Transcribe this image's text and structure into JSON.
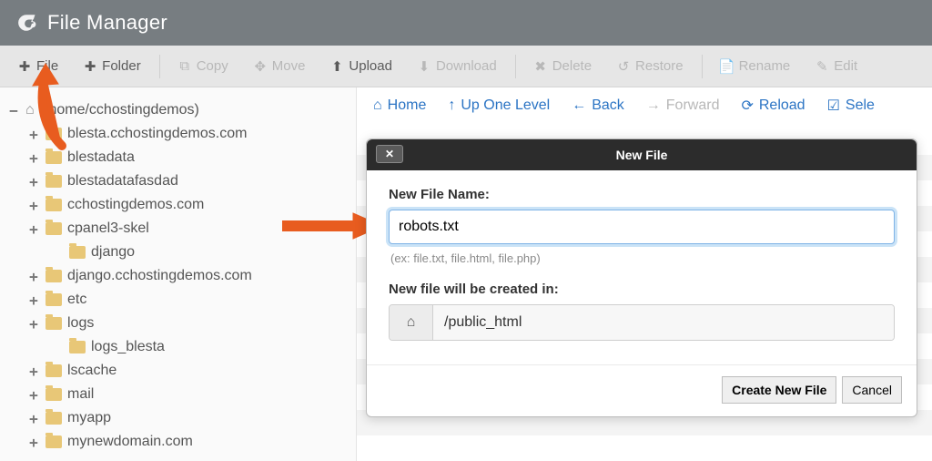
{
  "header": {
    "title": "File Manager"
  },
  "toolbar": {
    "file": "File",
    "folder": "Folder",
    "copy": "Copy",
    "move": "Move",
    "upload": "Upload",
    "download": "Download",
    "delete": "Delete",
    "restore": "Restore",
    "rename": "Rename",
    "edit": "Edit"
  },
  "tree": {
    "root_label": "(/home/cchostingdemos)",
    "items": [
      {
        "label": "blesta.cchostingdemos.com",
        "depth": 1,
        "toggle": "+"
      },
      {
        "label": "blestadata",
        "depth": 1,
        "toggle": "+"
      },
      {
        "label": "blestadatafasdad",
        "depth": 1,
        "toggle": "+"
      },
      {
        "label": "cchostingdemos.com",
        "depth": 1,
        "toggle": "+"
      },
      {
        "label": "cpanel3-skel",
        "depth": 1,
        "toggle": "+"
      },
      {
        "label": "django",
        "depth": 2,
        "toggle": ""
      },
      {
        "label": "django.cchostingdemos.com",
        "depth": 1,
        "toggle": "+"
      },
      {
        "label": "etc",
        "depth": 1,
        "toggle": "+"
      },
      {
        "label": "logs",
        "depth": 1,
        "toggle": "+"
      },
      {
        "label": "logs_blesta",
        "depth": 2,
        "toggle": ""
      },
      {
        "label": "lscache",
        "depth": 1,
        "toggle": "+"
      },
      {
        "label": "mail",
        "depth": 1,
        "toggle": "+"
      },
      {
        "label": "myapp",
        "depth": 1,
        "toggle": "+"
      },
      {
        "label": "mynewdomain.com",
        "depth": 1,
        "toggle": "+"
      }
    ]
  },
  "contentnav": {
    "home": "Home",
    "up": "Up One Level",
    "back": "Back",
    "forward": "Forward",
    "reload": "Reload",
    "select": "Sele"
  },
  "modal": {
    "title": "New File",
    "label_name": "New File Name:",
    "value_name": "robots.txt",
    "hint": "(ex: file.txt, file.html, file.php)",
    "label_path": "New file will be created in:",
    "path": "/public_html",
    "btn_primary": "Create New File",
    "btn_cancel": "Cancel"
  },
  "colors": {
    "accent_arrow": "#e85c1f",
    "link": "#2b74c4"
  }
}
